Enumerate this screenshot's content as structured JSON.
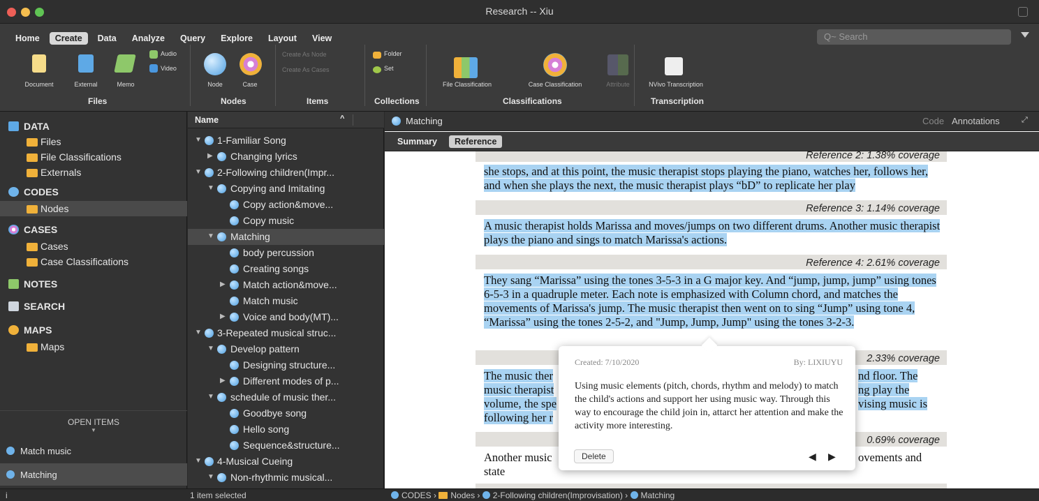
{
  "window": {
    "title": "Research -- Xiu"
  },
  "ribbon": {
    "tabs": [
      "Home",
      "Create",
      "Data",
      "Analyze",
      "Query",
      "Explore",
      "Layout",
      "View"
    ],
    "search_placeholder": "Q~ Search",
    "files": {
      "document": "Document",
      "external": "External",
      "memo": "Memo",
      "audio": "Audio",
      "video": "Video",
      "group": "Files"
    },
    "nodes": {
      "node": "Node",
      "case": "Case",
      "group": "Nodes"
    },
    "items": {
      "create_as_node": "Create As Node",
      "create_as_cases": "Create As Cases",
      "group": "Items"
    },
    "collections": {
      "folder": "Folder",
      "set": "Set",
      "group": "Collections"
    },
    "classifications": {
      "file": "File Classification",
      "case": "Case Classification",
      "attribute": "Attribute",
      "group": "Classifications"
    },
    "transcription": {
      "nvivo": "NVivo Transcription",
      "group": "Transcription"
    }
  },
  "sidebar": {
    "data_header": "DATA",
    "files": "Files",
    "file_classifications": "File Classifications",
    "externals": "Externals",
    "codes_header": "CODES",
    "nodes": "Nodes",
    "cases_header": "CASES",
    "cases": "Cases",
    "case_classifications": "Case Classifications",
    "notes_header": "NOTES",
    "search_header": "SEARCH",
    "maps_header": "MAPS",
    "maps": "Maps",
    "open_items": "OPEN ITEMS",
    "open_item_1": "Match music",
    "open_item_2": "Matching",
    "info": "i"
  },
  "tree": {
    "header": "Name",
    "rows": [
      "1-Familiar Song",
      "Changing lyrics",
      "2-Following children(Impr...",
      "Copying and Imitating",
      "Copy action&move...",
      "Copy music",
      "Matching",
      "body percussion",
      "Creating songs",
      "Match action&move...",
      "Match music",
      "Voice and body(MT)...",
      "3-Repeated musical struc...",
      "Develop pattern",
      "Designing structure...",
      "Different modes of p...",
      "schedule of music ther...",
      "Goodbye song",
      "Hello song",
      "Sequence&structure...",
      "4-Musical Cueing",
      "Non-rhythmic musical..."
    ],
    "status": "1 item selected"
  },
  "main": {
    "title": "Matching",
    "code": "Code",
    "annotations": "Annotations",
    "tab_summary": "Summary",
    "tab_reference": "Reference",
    "ref2": "Reference 2: 1.38% coverage",
    "para2": "she stops, and at this point, the music therapist stops playing the piano, watches her, follows her, and when she plays the next, the music therapist plays “bD” to replicate her play",
    "ref3": "Reference 3: 1.14% coverage",
    "para3": "A music therapist holds Marissa and moves/jumps on two different drums. Another music therapist plays the piano and sings to match Marissa's actions.",
    "ref4": "Reference 4: 2.61% coverage",
    "para4": "They sang “Marissa” using the tones 3-5-3 in a G major key. And “jump, jump, jump” using tones 6-5-3 in a quadruple meter. Each note is emphasized with Column chord, and matches the movements of Marissa's jump. The music therapist then went on to sing “Jump” using tone 4, “Marissa” using the tones 2-5-2, and \"Jump, Jump, Jump\" using the tones 3-2-3.",
    "ref5": "2.33% coverage",
    "para5a": "The music ther",
    "para5a_r": "nd floor. The",
    "para5b": "music therapist",
    "para5b_r": "ng play the",
    "para5c": "volume, the spe",
    "para5c_r": "vising music is",
    "para5d": "following her r",
    "ref6": "0.69% coverage",
    "para6a": "Another music",
    "para6a_r": "ovements and",
    "para6b": "state"
  },
  "popup": {
    "created": "Created: 7/10/2020",
    "by": "By: LIXIUYU",
    "text": "Using music elements (pitch, chords, rhythm and melody) to match the child's actions and support her using music way. Through this way to encourage the child join in, attarct her attention and make the activity more interesting.",
    "delete": "Delete"
  },
  "breadcrumb": {
    "codes": "CODES",
    "nodes": "Nodes",
    "parent": "2-Following children(Improvisation)",
    "current": "Matching"
  }
}
